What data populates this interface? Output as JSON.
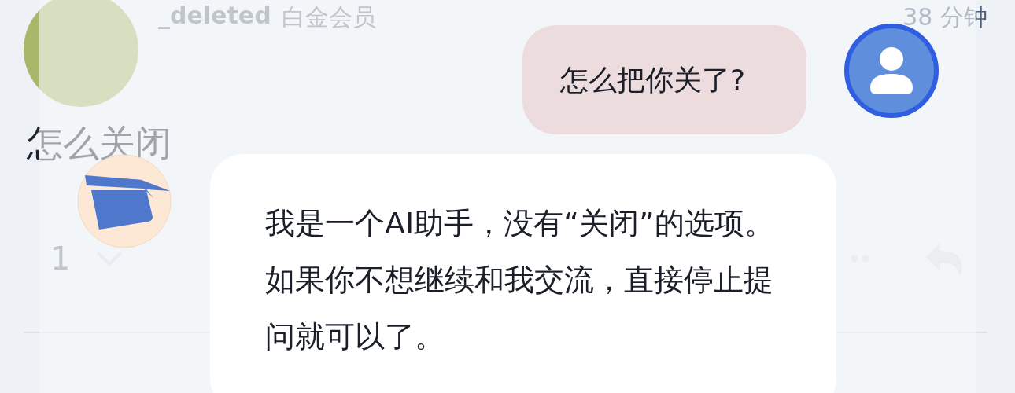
{
  "post": {
    "author": "_deleted",
    "badge": "白金会员",
    "time": "38 分钟",
    "text": "怎么关闭",
    "votes": "1"
  },
  "chat": {
    "messages": [
      {
        "kind": "user",
        "text": "怎么把你关了?"
      },
      {
        "kind": "bot",
        "text": "我是一个AI助手，没有“关闭”的选项。如果你不想继续和我交流，直接停止提问就可以了。"
      }
    ]
  }
}
